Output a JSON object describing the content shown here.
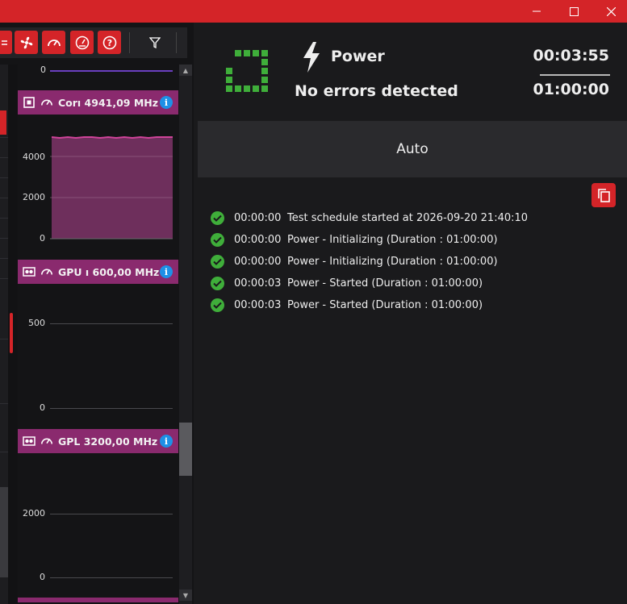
{
  "window": {
    "controls": [
      "minimize-icon",
      "maximize-icon",
      "close-icon"
    ]
  },
  "toolbar": {
    "icons": [
      "menu-icon",
      "fan-icon",
      "gauge-icon",
      "dashboard-icon",
      "help-icon",
      "filter-icon"
    ]
  },
  "panels": [
    {
      "label": "Corı 4941,09 MHz",
      "icon": "cpu-icon",
      "ticks": [
        "4000",
        "2000",
        "0"
      ]
    },
    {
      "label": "GPU ı 600,00 MHz",
      "icon": "gpu-icon",
      "ticks": [
        "500",
        "0"
      ]
    },
    {
      "label": "GPL 3200,00 MHz",
      "icon": "gpu-icon",
      "ticks": [
        "2000",
        "0"
      ]
    }
  ],
  "top_tick": "0",
  "status": {
    "test_name": "Power",
    "message": "No errors detected",
    "elapsed": "00:03:55",
    "total": "01:00:00"
  },
  "mode": "Auto",
  "log": [
    {
      "time": "00:00:00",
      "text": "Test schedule started at 2026-09-20 21:40:10"
    },
    {
      "time": "00:00:00",
      "text": "Power - Initializing (Duration : 01:00:00)"
    },
    {
      "time": "00:00:00",
      "text": "Power - Initializing (Duration : 01:00:00)"
    },
    {
      "time": "00:00:03",
      "text": "Power - Started (Duration : 01:00:00)"
    },
    {
      "time": "00:00:03",
      "text": "Power - Started (Duration : 01:00:00)"
    }
  ],
  "colors": {
    "accent": "#d42428",
    "panel_header": "#8a2a6e",
    "chart_fill": "#6e2f5c",
    "chart_line": "#d0449a",
    "ok": "#3fae3a",
    "info": "#1e90e6"
  }
}
